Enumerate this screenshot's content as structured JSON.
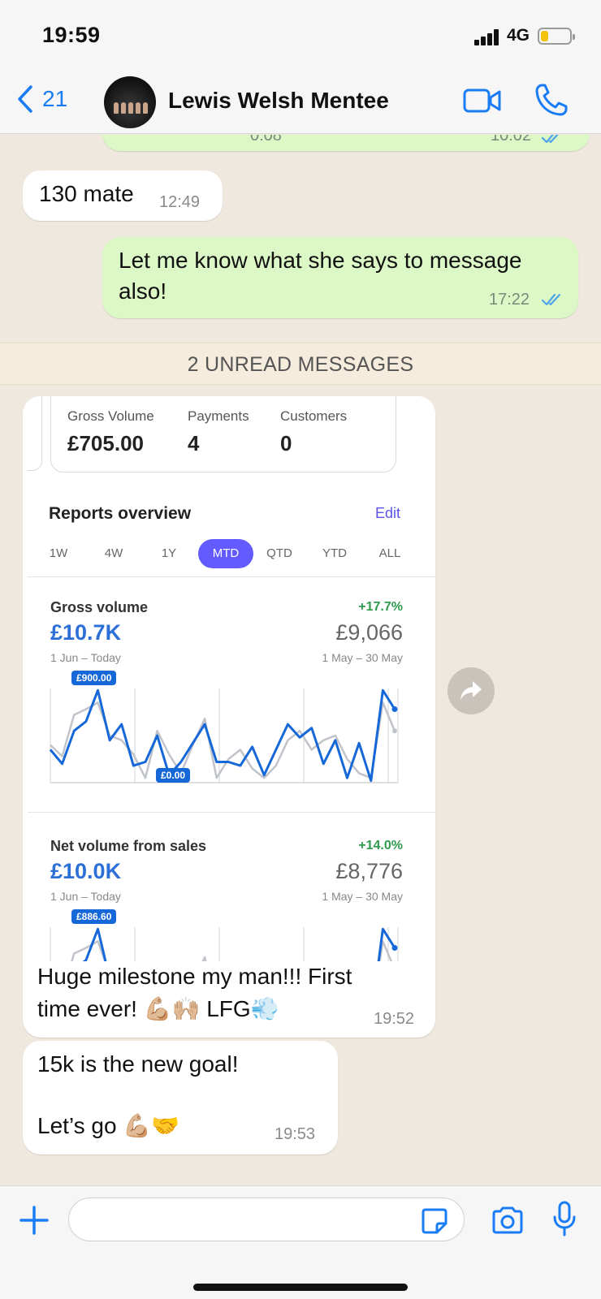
{
  "status_bar": {
    "time": "19:59",
    "network": "4G",
    "battery_level": 0.25,
    "battery_color": "#f3c20a"
  },
  "header": {
    "back_count": "21",
    "contact_name": "Lewis Welsh Mentee",
    "accent_color": "#1a7cf5"
  },
  "messages": {
    "top_partial": {
      "duration": "0:08",
      "time": "10:02"
    },
    "msg1": {
      "text": "130 mate",
      "time": "12:49"
    },
    "msg2": {
      "line1": "Let me know what she says to message",
      "line2": "also!",
      "time": "17:22"
    },
    "unread_label": "2 UNREAD MESSAGES",
    "msg3": {
      "line1": "Huge milestone my man!!! First",
      "line2": "time ever! 💪🏼🙌🏼 LFG💨",
      "time": "19:52"
    },
    "msg4": {
      "line1": "15k is the new goal!",
      "line2": "Let’s go 💪🏼🤝",
      "time": "19:53"
    }
  },
  "dashboard": {
    "stats": [
      {
        "label": "Gross Volume",
        "value": "£705.00"
      },
      {
        "label": "Payments",
        "value": "4"
      },
      {
        "label": "Customers",
        "value": "0"
      }
    ],
    "reports_title": "Reports overview",
    "edit_label": "Edit",
    "tabs": [
      "1W",
      "4W",
      "1Y",
      "MTD",
      "QTD",
      "YTD",
      "ALL"
    ],
    "active_tab": "MTD",
    "metrics": [
      {
        "label": "Gross volume",
        "change": "+17.7%",
        "value": "£10.7K",
        "previous": "£9,066",
        "range": "1 Jun – Today",
        "prev_range": "1 May – 30 May",
        "max_tag": "£900.00",
        "min_tag": "£0.00"
      },
      {
        "label": "Net volume from sales",
        "change": "+14.0%",
        "value": "£10.0K",
        "previous": "£8,776",
        "range": "1 Jun – Today",
        "prev_range": "1 May – 30 May",
        "max_tag": "£886.60"
      }
    ],
    "series_current": [
      0.35,
      0.2,
      0.55,
      0.65,
      0.98,
      0.45,
      0.62,
      0.18,
      0.22,
      0.5,
      0.08,
      0.22,
      0.42,
      0.62,
      0.22,
      0.22,
      0.18,
      0.38,
      0.08,
      0.35,
      0.62,
      0.48,
      0.58,
      0.2,
      0.45,
      0.05,
      0.42,
      0.02,
      0.98,
      0.78
    ],
    "series_previous": [
      0.4,
      0.28,
      0.72,
      0.78,
      0.85,
      0.5,
      0.45,
      0.3,
      0.05,
      0.55,
      0.3,
      0.1,
      0.4,
      0.68,
      0.05,
      0.25,
      0.35,
      0.15,
      0.05,
      0.18,
      0.45,
      0.55,
      0.35,
      0.45,
      0.5,
      0.25,
      0.1,
      0.05,
      0.85,
      0.55
    ],
    "current_color": "#1668d8",
    "previous_color": "#c0c4ca",
    "brand_color": "#635bff"
  }
}
